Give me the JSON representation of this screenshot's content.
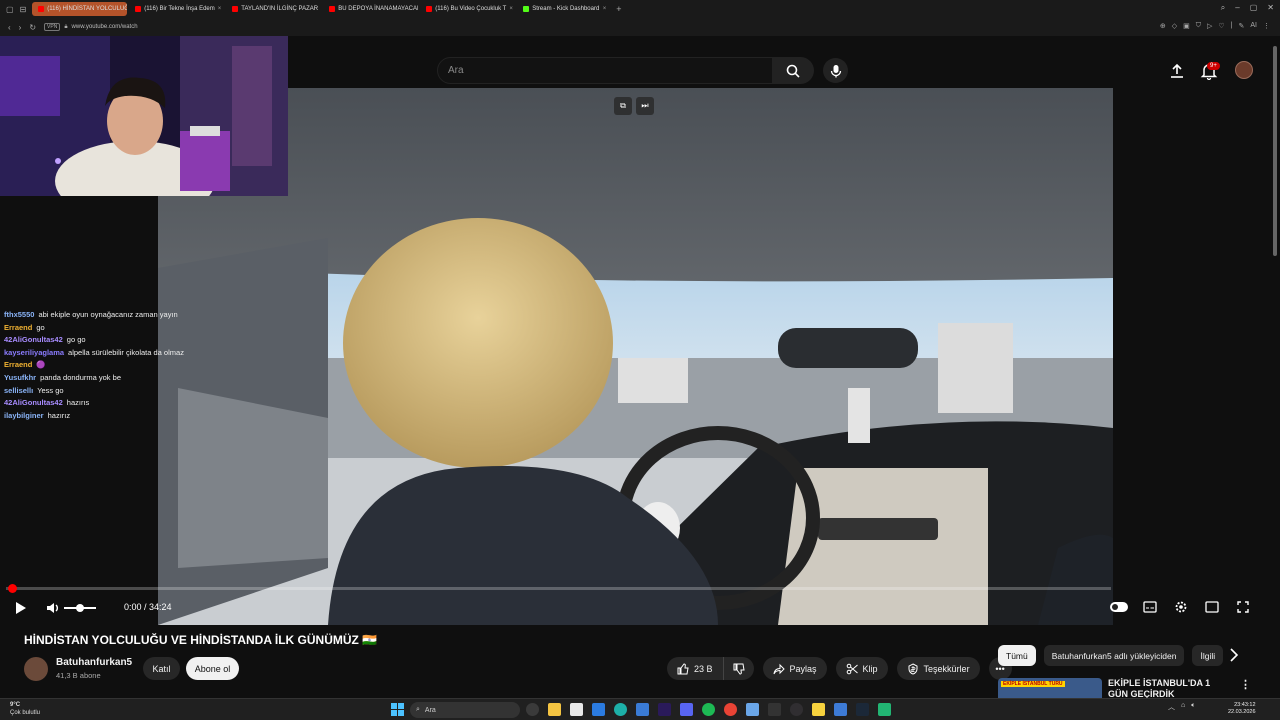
{
  "browser": {
    "tabs": [
      {
        "label": "(116) HİNDİSTAN YOLCULUĞU",
        "icon": "youtube-icon",
        "active": true
      },
      {
        "label": "(116) Bir Tekne İnşa Edem",
        "icon": "youtube-icon",
        "active": false
      },
      {
        "label": "TAYLAND'IN İLGİNÇ PAZAR",
        "icon": "youtube-icon",
        "active": false
      },
      {
        "label": "BU DEPOYA İNANAMAYACAKS",
        "icon": "youtube-icon",
        "active": false
      },
      {
        "label": "(116) Bu Video Çocukluk T",
        "icon": "youtube-icon",
        "active": false
      },
      {
        "label": "Stream - Kick Dashboard",
        "icon": "kick-icon",
        "active": false
      }
    ],
    "vpn_label": "VPN",
    "url": "www.youtube.com/watch",
    "ai_label": "AI"
  },
  "youtube": {
    "search_placeholder": "Ara",
    "notification_count": "9+",
    "video": {
      "time_display": "0:00 / 34:24",
      "progress": 0.0,
      "volume": 0.5
    },
    "title": "HİNDİSTAN YOLCULUĞU VE HİNDİSTANDA İLK GÜNÜMÜZ 🇮🇳",
    "channel": {
      "name": "Batuhanfurkan5",
      "subscribers": "41,3 B abone",
      "join_label": "Katıl",
      "subscribe_label": "Abone ol"
    },
    "actions": {
      "like_count": "23 B",
      "share_label": "Paylaş",
      "clip_label": "Klip",
      "thanks_label": "Teşekkürler"
    },
    "chips": [
      "Tümü",
      "Batuhanfurkan5 adlı yükleyiciden",
      "İlgili"
    ],
    "related": {
      "thumb_text": "EKİPLE İSTANBUL TURU",
      "title": "EKİPLE İSTANBUL'DA 1 GÜN GEÇİRDİK"
    }
  },
  "chat": [
    {
      "user": "fthx5550",
      "msg": "abi ekiple oyun oynağacanız zaman yayın",
      "color": "#8ab4f8"
    },
    {
      "user": "Erraend",
      "msg": "go",
      "color": "#f0b232"
    },
    {
      "user": "42AliGonultas42",
      "msg": "go go",
      "color": "#a88cff"
    },
    {
      "user": "kayseriliyaglama",
      "msg": "alpella sürülebilir çikolata da olmaz",
      "color": "#8b7cff"
    },
    {
      "user": "Erraend",
      "msg": "🟣",
      "color": "#f0b232"
    },
    {
      "user": "Yusufkhr",
      "msg": "panda dondurma yok be",
      "color": "#8ab4f8"
    },
    {
      "user": "sellisellı",
      "msg": "Yess go",
      "color": "#8ab4f8"
    },
    {
      "user": "42AliGonultas42",
      "msg": "hazırıs",
      "color": "#a88cff"
    },
    {
      "user": "ilaybilginer",
      "msg": "hazırız",
      "color": "#8ab4f8"
    }
  ],
  "taskbar": {
    "weather_temp": "9°C",
    "weather_desc": "Çok bulutlu",
    "search_label": "Ara",
    "time": "23:43:12",
    "date": "22.03.2026"
  }
}
